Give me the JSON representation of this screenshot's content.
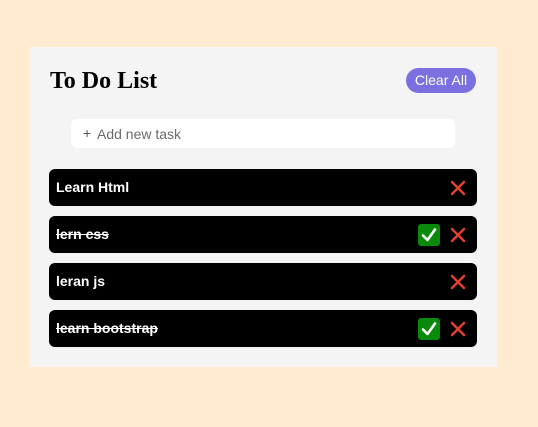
{
  "header": {
    "title": "To Do List",
    "clear_label": "Clear All"
  },
  "add_task": {
    "icon_glyph": "+",
    "placeholder": "Add new task"
  },
  "tasks": [
    {
      "label": "Learn Html",
      "completed": false
    },
    {
      "label": "lern css",
      "completed": true
    },
    {
      "label": "leran js",
      "completed": false
    },
    {
      "label": "learn bootstrap",
      "completed": true
    }
  ],
  "colors": {
    "page_background": "#ffebcf",
    "card_background": "#f4f4f4",
    "accent": "#7b70e0",
    "task_background": "#000000",
    "check_green": "#0a8a0a",
    "delete_red": "#e0402f"
  },
  "icons": {
    "complete": "check-icon",
    "delete": "close-icon"
  }
}
